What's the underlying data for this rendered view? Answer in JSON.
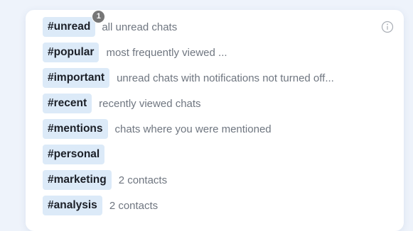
{
  "colors": {
    "tag_background": "#dceaf8",
    "tag_text": "#1b1f27",
    "description_text": "#6f7680",
    "badge_background": "#777777",
    "page_background": "#eef3fb"
  },
  "info_icon": "info-circle-icon",
  "items": [
    {
      "tag": "#unread",
      "badge": "1",
      "description": "all unread chats"
    },
    {
      "tag": "#popular",
      "description": "most frequently viewed ..."
    },
    {
      "tag": "#important",
      "description": "unread chats with notifications not turned off..."
    },
    {
      "tag": "#recent",
      "description": "recently viewed chats"
    },
    {
      "tag": "#mentions",
      "description": "chats where you were mentioned"
    },
    {
      "tag": "#personal",
      "description": ""
    },
    {
      "tag": "#marketing",
      "description": "2 contacts"
    },
    {
      "tag": "#analysis",
      "description": "2 contacts"
    }
  ]
}
